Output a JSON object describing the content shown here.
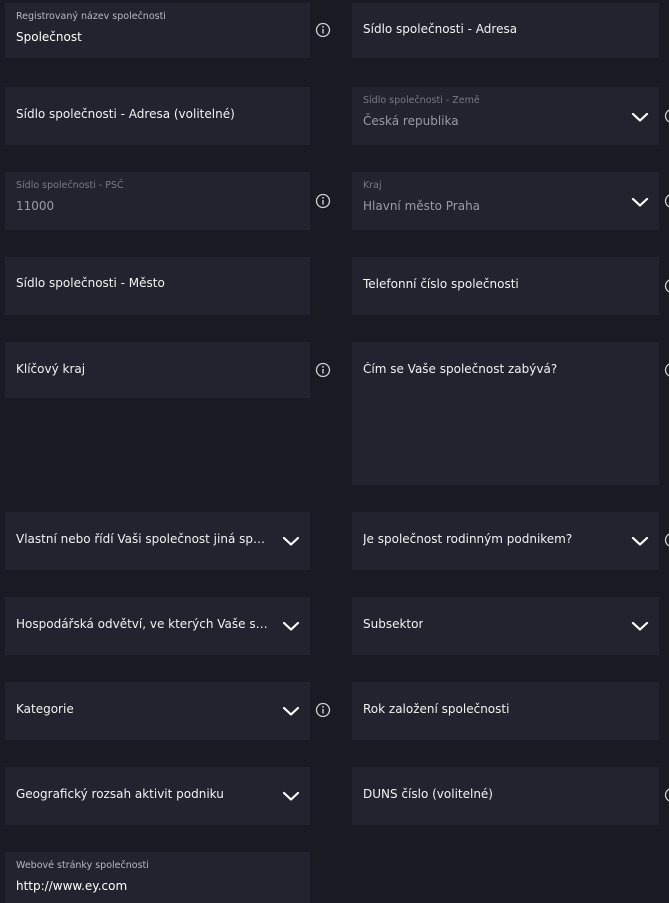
{
  "fields": {
    "reg_name": {
      "label": "Registrovaný název společnosti",
      "value": "Společnost"
    },
    "hq_address": {
      "label": "Sídlo společnosti - Adresa"
    },
    "hq_address_opt": {
      "label": "Sídlo společnosti - Adresa (volitelné)"
    },
    "hq_country": {
      "label": "Sídlo společnosti - Země",
      "value": "Česká republika"
    },
    "hq_zip": {
      "label": "Sídlo společnosti - PSČ",
      "value": "11000"
    },
    "region": {
      "label": "Kraj",
      "value": "Hlavní město Praha"
    },
    "hq_city": {
      "label": "Sídlo společnosti - Město"
    },
    "phone": {
      "label": "Telefonní číslo společnosti"
    },
    "key_region": {
      "label": "Klíčový kraj"
    },
    "business_desc": {
      "label": "Čím se Vaše společnost zabývá?"
    },
    "owned_by_other": {
      "label": "Vlastní nebo řídí Vaši společnost jiná společn..."
    },
    "family_business": {
      "label": "Je společnost rodinným podnikem?"
    },
    "sectors": {
      "label": "Hospodářská odvětví, ve kterých Vaše společ..."
    },
    "subsector": {
      "label": "Subsektor"
    },
    "category": {
      "label": "Kategorie"
    },
    "founded_year": {
      "label": "Rok založení společnosti"
    },
    "geo_scope": {
      "label": "Geografický rozsah aktivit podniku"
    },
    "duns": {
      "label": "DUNS číslo (volitelné)"
    },
    "website": {
      "label": "Webové stránky společnosti",
      "value": "http://www.ey.com"
    }
  },
  "colors": {
    "background": "#1a1a24",
    "field": "#23232f",
    "text": "#ffffff",
    "muted": "#9a9aa6"
  },
  "icons": {
    "dropdown": "chevron-down-icon",
    "info": "info-icon"
  }
}
